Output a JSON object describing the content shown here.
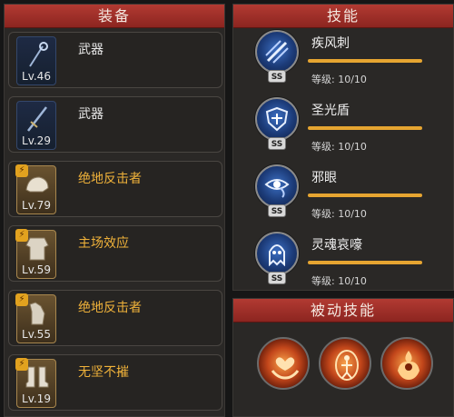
{
  "equipment": {
    "title": "装备",
    "items": [
      {
        "name": "武器",
        "level": "Lv.46",
        "rarity": "blue",
        "icon": "staff-icon",
        "badge": ""
      },
      {
        "name": "武器",
        "level": "Lv.29",
        "rarity": "blue",
        "icon": "sword-icon",
        "badge": ""
      },
      {
        "name": "绝地反击者",
        "level": "Lv.79",
        "rarity": "gold",
        "icon": "helmet-icon",
        "badge": "⚡"
      },
      {
        "name": "主场效应",
        "level": "Lv.59",
        "rarity": "gold",
        "icon": "armor-icon",
        "badge": "⚡"
      },
      {
        "name": "绝地反击者",
        "level": "Lv.55",
        "rarity": "gold",
        "icon": "gauntlet-icon",
        "badge": "⚡"
      },
      {
        "name": "无坚不摧",
        "level": "Lv.19",
        "rarity": "gold",
        "icon": "boots-icon",
        "badge": "⚡"
      }
    ]
  },
  "skills": {
    "title": "技能",
    "items": [
      {
        "name": "疾风刺",
        "rank": "SS",
        "level_text": "等级: 10/10",
        "progress": 1.0,
        "icon": "wind-thrust-icon"
      },
      {
        "name": "圣光盾",
        "rank": "SS",
        "level_text": "等级: 10/10",
        "progress": 1.0,
        "icon": "holy-shield-icon"
      },
      {
        "name": "邪眼",
        "rank": "SS",
        "level_text": "等级: 10/10",
        "progress": 1.0,
        "icon": "evil-eye-icon"
      },
      {
        "name": "灵魂哀嚎",
        "rank": "SS",
        "level_text": "等级: 10/10",
        "progress": 1.0,
        "icon": "soul-wail-icon"
      }
    ]
  },
  "passive": {
    "title": "被动技能",
    "icons": [
      "heart-hands-icon",
      "flame-figure-icon",
      "burning-warrior-icon"
    ]
  },
  "colors": {
    "header_red": "#a8302a",
    "gold_text": "#f0b23a",
    "bar_fill": "#e6a531"
  }
}
